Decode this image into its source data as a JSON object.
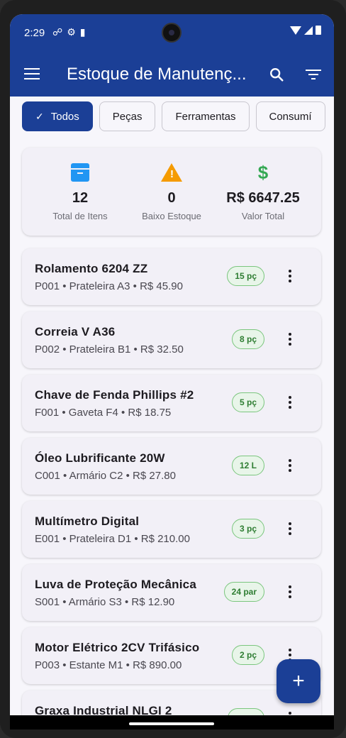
{
  "status": {
    "time": "2:29"
  },
  "app_bar": {
    "title": "Estoque de Manutenç..."
  },
  "filters": [
    "Todos",
    "Peças",
    "Ferramentas",
    "Consumí"
  ],
  "summary": {
    "total_items": {
      "value": "12",
      "label": "Total de Itens",
      "icon": "archive-icon"
    },
    "low_stock": {
      "value": "0",
      "label": "Baixo Estoque",
      "icon": "warning-icon"
    },
    "total_value": {
      "value": "R$ 6647.25",
      "label": "Valor Total",
      "icon": "dollar-icon"
    }
  },
  "items": [
    {
      "name": "Rolamento 6204 ZZ",
      "sub": "P001 • Prateleira A3 • R$ 45.90",
      "qty": "15 pç"
    },
    {
      "name": "Correia V A36",
      "sub": "P002 • Prateleira B1 • R$ 32.50",
      "qty": "8 pç"
    },
    {
      "name": "Chave de Fenda Phillips #2",
      "sub": "F001 • Gaveta F4 • R$ 18.75",
      "qty": "5 pç"
    },
    {
      "name": "Óleo Lubrificante 20W",
      "sub": "C001 • Armário C2 • R$ 27.80",
      "qty": "12 L"
    },
    {
      "name": "Multímetro Digital",
      "sub": "E001 • Prateleira D1 • R$ 210.00",
      "qty": "3 pç"
    },
    {
      "name": "Luva de Proteção Mecânica",
      "sub": "S001 • Armário S3 • R$ 12.90",
      "qty": "24 par"
    },
    {
      "name": "Motor Elétrico 2CV Trifásico",
      "sub": "P003 • Estante M1 • R$ 890.00",
      "qty": "2 pç"
    },
    {
      "name": "Graxa Industrial NLGI 2",
      "sub": "",
      "qty": ""
    }
  ],
  "fab": {
    "label": "+"
  },
  "colors": {
    "primary": "#1b3f96",
    "badge_green": "#2e7d32",
    "warning": "#f59b00",
    "info": "#2196f3",
    "money": "#34a853"
  }
}
